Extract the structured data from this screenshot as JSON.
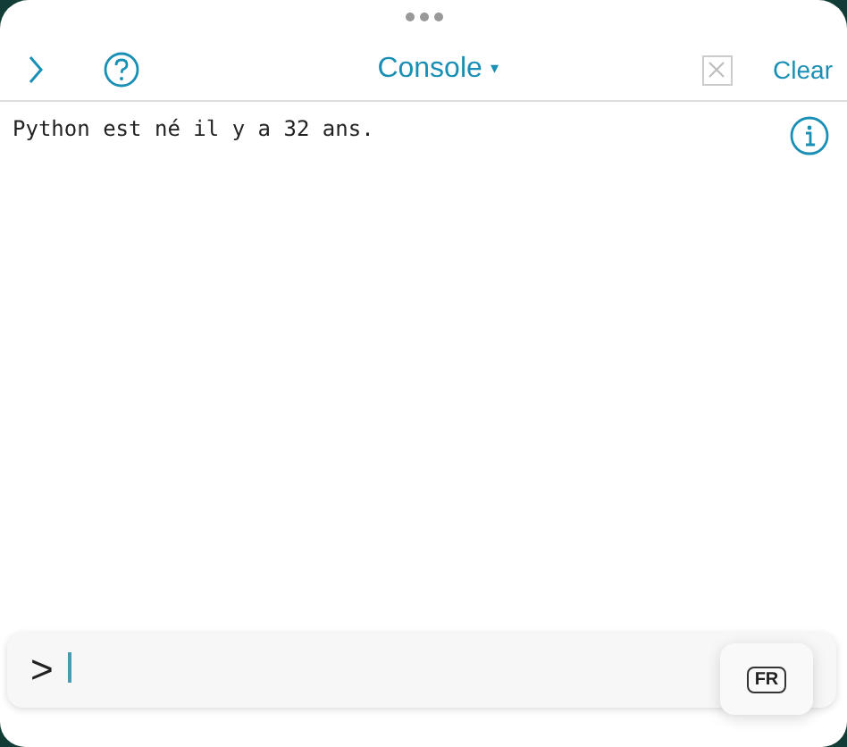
{
  "toolbar": {
    "title": "Console",
    "dropdown_mark": "▾",
    "clear_label": "Clear",
    "stop_button": {
      "disabled": true
    }
  },
  "output": [
    "Python est né il y a 32 ans."
  ],
  "prompt": {
    "symbol": ">"
  },
  "keyboard_popup": {
    "label": "FR"
  }
}
